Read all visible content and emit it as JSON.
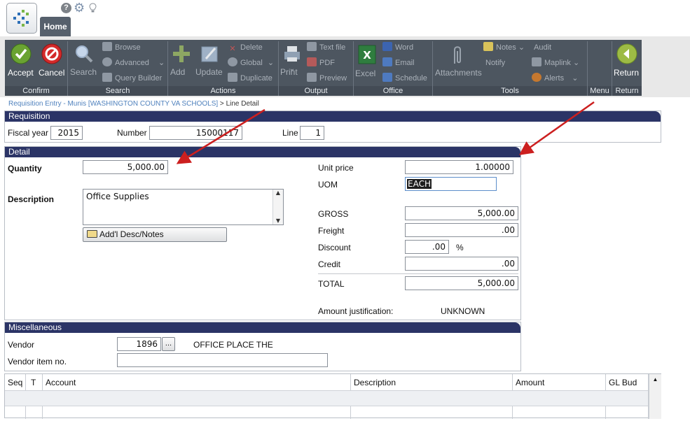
{
  "toolbar": {
    "home_tab": "Home",
    "confirm": {
      "label": "Confirm",
      "accept": "Accept",
      "cancel": "Cancel"
    },
    "search": {
      "label": "Search",
      "search": "Search",
      "browse": "Browse",
      "advanced": "Advanced",
      "query_builder": "Query Builder"
    },
    "actions": {
      "label": "Actions",
      "add": "Add",
      "update": "Update",
      "delete": "Delete",
      "global": "Global",
      "duplicate": "Duplicate"
    },
    "output": {
      "label": "Output",
      "print": "Print",
      "text_file": "Text file",
      "pdf": "PDF",
      "preview": "Preview"
    },
    "office": {
      "label": "Office",
      "excel": "Excel",
      "word": "Word",
      "email": "Email",
      "schedule": "Schedule"
    },
    "tools": {
      "label": "Tools",
      "attachments": "Attachments",
      "notes": "Notes",
      "notify": "Notify",
      "audit": "Audit",
      "maplink": "Maplink",
      "alerts": "Alerts"
    },
    "menu": {
      "label": "Menu"
    },
    "return": {
      "label": "Return",
      "return": "Return"
    }
  },
  "breadcrumb": {
    "link": "Requisition Entry - Munis [WASHINGTON COUNTY VA SCHOOLS]",
    "separator": " > ",
    "current": "Line Detail"
  },
  "requisition": {
    "title": "Requisition",
    "fiscal_year_label": "Fiscal year",
    "fiscal_year": "2015",
    "number_label": "Number",
    "number": "15000117",
    "line_label": "Line",
    "line": "1"
  },
  "detail": {
    "title": "Detail",
    "quantity_label": "Quantity",
    "quantity": "5,000.00",
    "description_label": "Description",
    "description": "Office Supplies",
    "addl_button": "Add'l Desc/Notes",
    "unit_price_label": "Unit price",
    "unit_price": "1.00000",
    "uom_label": "UOM",
    "uom": "EACH",
    "gross_label": "GROSS",
    "gross": "5,000.00",
    "freight_label": "Freight",
    "freight": ".00",
    "discount_label": "Discount",
    "discount": ".00",
    "discount_unit": "%",
    "credit_label": "Credit",
    "credit": ".00",
    "total_label": "TOTAL",
    "total": "5,000.00",
    "justification_label": "Amount justification:",
    "justification": "UNKNOWN"
  },
  "misc": {
    "title": "Miscellaneous",
    "vendor_label": "Vendor",
    "vendor": "1896",
    "vendor_lookup": "...",
    "vendor_name": "OFFICE PLACE THE",
    "vendor_item_label": "Vendor item no.",
    "vendor_item": ""
  },
  "grid": {
    "columns": [
      "Seq",
      "T",
      "Account",
      "Description",
      "Amount",
      "GL Bud"
    ]
  },
  "colors": {
    "accent_panel": "#2b3466",
    "ribbon": "#4d5660",
    "arrow": "#cc1f1f"
  }
}
